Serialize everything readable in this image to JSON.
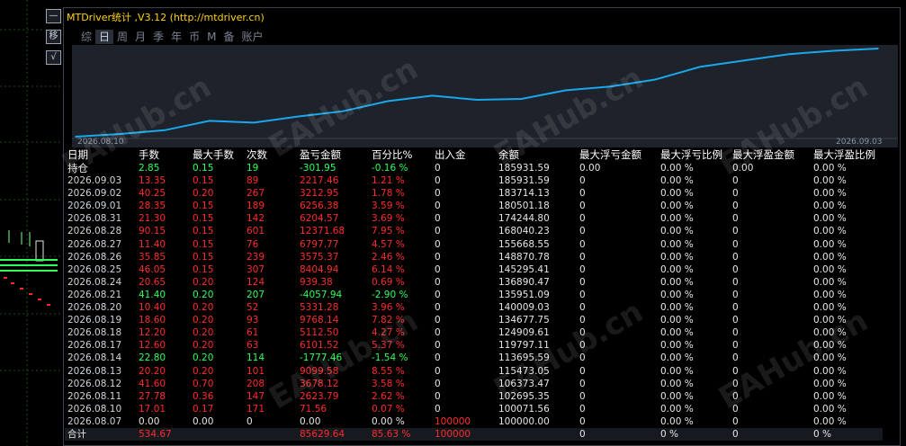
{
  "window": {
    "title": "MTDriver统计 ,V3.12 (http://mtdriver.cn)"
  },
  "side_buttons": [
    "—",
    "移",
    "√"
  ],
  "tabs": [
    "综",
    "日",
    "周",
    "月",
    "季",
    "年",
    "币",
    "M",
    "备",
    "账户"
  ],
  "active_tab": "日",
  "chart": {
    "start_date": "2026.08.10",
    "end_date": "2026.09.03"
  },
  "chart_data": {
    "type": "line",
    "x": [
      "2026.08.10",
      "2026.08.11",
      "2026.08.12",
      "2026.08.13",
      "2026.08.14",
      "2026.08.17",
      "2026.08.18",
      "2026.08.19",
      "2026.08.20",
      "2026.08.21",
      "2026.08.24",
      "2026.08.25",
      "2026.08.26",
      "2026.08.27",
      "2026.08.28",
      "2026.08.31",
      "2026.09.01",
      "2026.09.02",
      "2026.09.03"
    ],
    "series": [
      {
        "values": [
          100071.56,
          102695.35,
          106373.47,
          115473.05,
          113695.59,
          119797.11,
          124909.61,
          134677.75,
          140009.03,
          135951.09,
          136890.47,
          145295.41,
          148870.78,
          155668.55,
          168040.23,
          174244.8,
          180501.18,
          183714.13,
          185931.59
        ]
      }
    ],
    "line_color": "#1aa7ec",
    "background": "#1e222a"
  },
  "table": {
    "headers": [
      "日期",
      "手数",
      "最大手数",
      "次数",
      "盈亏金额",
      "百分比%",
      "出入金",
      "余额",
      "最大浮亏金额",
      "最大浮亏比例",
      "最大浮盈金额",
      "最大浮盈比例"
    ],
    "holding": {
      "label": "持仓",
      "lots": "2.85",
      "max_lots": "0.15",
      "count": "19",
      "pnl": "-301.95",
      "pct": "-0.16 %",
      "io": "0",
      "balance": "185931.59",
      "max_dd": "0.00",
      "max_dd_pct": "0.00 %",
      "max_fp": "0.00",
      "max_fp_pct": "0.00 %"
    },
    "rows": [
      {
        "date": "2026.09.03",
        "lots": "13.35",
        "max_lots": "0.15",
        "count": "89",
        "pnl": "2217.46",
        "pct": "1.21 %",
        "io": "0",
        "balance": "185931.59",
        "dd": "0",
        "dd_pct": "0.00 %",
        "fp": "0",
        "fp_pct": "0.00 %",
        "color": "red"
      },
      {
        "date": "2026.09.02",
        "lots": "40.25",
        "max_lots": "0.20",
        "count": "267",
        "pnl": "3212.95",
        "pct": "1.78 %",
        "io": "0",
        "balance": "183714.13",
        "dd": "0",
        "dd_pct": "0.00 %",
        "fp": "0",
        "fp_pct": "0.00 %",
        "color": "red"
      },
      {
        "date": "2026.09.01",
        "lots": "28.35",
        "max_lots": "0.15",
        "count": "189",
        "pnl": "6256.38",
        "pct": "3.59 %",
        "io": "0",
        "balance": "180501.18",
        "dd": "0",
        "dd_pct": "0.00 %",
        "fp": "0",
        "fp_pct": "0.00 %",
        "color": "red"
      },
      {
        "date": "2026.08.31",
        "lots": "21.30",
        "max_lots": "0.15",
        "count": "142",
        "pnl": "6204.57",
        "pct": "3.69 %",
        "io": "0",
        "balance": "174244.80",
        "dd": "0",
        "dd_pct": "0.00 %",
        "fp": "0",
        "fp_pct": "0.00 %",
        "color": "red"
      },
      {
        "date": "2026.08.28",
        "lots": "90.15",
        "max_lots": "0.15",
        "count": "601",
        "pnl": "12371.68",
        "pct": "7.95 %",
        "io": "0",
        "balance": "168040.23",
        "dd": "0",
        "dd_pct": "0.00 %",
        "fp": "0",
        "fp_pct": "0.00 %",
        "color": "red"
      },
      {
        "date": "2026.08.27",
        "lots": "11.40",
        "max_lots": "0.15",
        "count": "76",
        "pnl": "6797.77",
        "pct": "4.57 %",
        "io": "0",
        "balance": "155668.55",
        "dd": "0",
        "dd_pct": "0.00 %",
        "fp": "0",
        "fp_pct": "0.00 %",
        "color": "red"
      },
      {
        "date": "2026.08.26",
        "lots": "35.85",
        "max_lots": "0.15",
        "count": "239",
        "pnl": "3575.37",
        "pct": "2.46 %",
        "io": "0",
        "balance": "148870.78",
        "dd": "0",
        "dd_pct": "0.00 %",
        "fp": "0",
        "fp_pct": "0.00 %",
        "color": "red"
      },
      {
        "date": "2026.08.25",
        "lots": "46.05",
        "max_lots": "0.15",
        "count": "307",
        "pnl": "8404.94",
        "pct": "6.14 %",
        "io": "0",
        "balance": "145295.41",
        "dd": "0",
        "dd_pct": "0.00 %",
        "fp": "0",
        "fp_pct": "0.00 %",
        "color": "red"
      },
      {
        "date": "2026.08.24",
        "lots": "20.65",
        "max_lots": "0.20",
        "count": "124",
        "pnl": "939.38",
        "pct": "0.69 %",
        "io": "0",
        "balance": "136890.47",
        "dd": "0",
        "dd_pct": "0.00 %",
        "fp": "0",
        "fp_pct": "0.00 %",
        "color": "red"
      },
      {
        "date": "2026.08.21",
        "lots": "41.40",
        "max_lots": "0.20",
        "count": "207",
        "pnl": "-4057.94",
        "pct": "-2.90 %",
        "io": "0",
        "balance": "135951.09",
        "dd": "0",
        "dd_pct": "0.00 %",
        "fp": "0",
        "fp_pct": "0.00 %",
        "color": "green"
      },
      {
        "date": "2026.08.20",
        "lots": "10.40",
        "max_lots": "0.20",
        "count": "52",
        "pnl": "5331.28",
        "pct": "3.96 %",
        "io": "0",
        "balance": "140009.03",
        "dd": "0",
        "dd_pct": "0.00 %",
        "fp": "0",
        "fp_pct": "0.00 %",
        "color": "red"
      },
      {
        "date": "2026.08.19",
        "lots": "18.60",
        "max_lots": "0.20",
        "count": "93",
        "pnl": "9768.14",
        "pct": "7.82 %",
        "io": "0",
        "balance": "134677.75",
        "dd": "0",
        "dd_pct": "0.00 %",
        "fp": "0",
        "fp_pct": "0.00 %",
        "color": "red"
      },
      {
        "date": "2026.08.18",
        "lots": "12.20",
        "max_lots": "0.20",
        "count": "61",
        "pnl": "5112.50",
        "pct": "4.27 %",
        "io": "0",
        "balance": "124909.61",
        "dd": "0",
        "dd_pct": "0.00 %",
        "fp": "0",
        "fp_pct": "0.00 %",
        "color": "red"
      },
      {
        "date": "2026.08.17",
        "lots": "12.60",
        "max_lots": "0.20",
        "count": "63",
        "pnl": "6101.52",
        "pct": "5.37 %",
        "io": "0",
        "balance": "119797.11",
        "dd": "0",
        "dd_pct": "0.00 %",
        "fp": "0",
        "fp_pct": "0.00 %",
        "color": "red"
      },
      {
        "date": "2026.08.14",
        "lots": "22.80",
        "max_lots": "0.20",
        "count": "114",
        "pnl": "-1777.46",
        "pct": "-1.54 %",
        "io": "0",
        "balance": "113695.59",
        "dd": "0",
        "dd_pct": "0.00 %",
        "fp": "0",
        "fp_pct": "0.00 %",
        "color": "green"
      },
      {
        "date": "2026.08.13",
        "lots": "20.20",
        "max_lots": "0.20",
        "count": "101",
        "pnl": "9099.58",
        "pct": "8.55 %",
        "io": "0",
        "balance": "115473.05",
        "dd": "0",
        "dd_pct": "0.00 %",
        "fp": "0",
        "fp_pct": "0.00 %",
        "color": "red"
      },
      {
        "date": "2026.08.12",
        "lots": "41.60",
        "max_lots": "0.70",
        "count": "208",
        "pnl": "3678.12",
        "pct": "3.58 %",
        "io": "0",
        "balance": "106373.47",
        "dd": "0",
        "dd_pct": "0.00 %",
        "fp": "0",
        "fp_pct": "0.00 %",
        "color": "red"
      },
      {
        "date": "2026.08.11",
        "lots": "27.78",
        "max_lots": "0.36",
        "count": "147",
        "pnl": "2623.79",
        "pct": "2.62 %",
        "io": "0",
        "balance": "102695.35",
        "dd": "0",
        "dd_pct": "0.00 %",
        "fp": "0",
        "fp_pct": "0.00 %",
        "color": "red"
      },
      {
        "date": "2026.08.10",
        "lots": "17.01",
        "max_lots": "0.17",
        "count": "171",
        "pnl": "71.56",
        "pct": "0.07 %",
        "io": "0",
        "balance": "100071.56",
        "dd": "0",
        "dd_pct": "0.00 %",
        "fp": "0",
        "fp_pct": "0.00 %",
        "color": "red"
      },
      {
        "date": "2026.08.07",
        "lots": "0.00",
        "max_lots": "0.00",
        "count": "0",
        "pnl": "0.00",
        "pct": "0.00 %",
        "io": "100000",
        "balance": "100000.00",
        "dd": "0",
        "dd_pct": "0.00 %",
        "fp": "0",
        "fp_pct": "0.00 %",
        "color": "white"
      }
    ],
    "total": {
      "label": "合计",
      "lots": "534.67",
      "pnl": "85629.64",
      "pct": "85.63 %",
      "io": "100000",
      "dd": "0",
      "dd_pct": "0 %",
      "fp": "0",
      "fp_pct": "0 %"
    }
  },
  "watermark": "EAHub.cn"
}
